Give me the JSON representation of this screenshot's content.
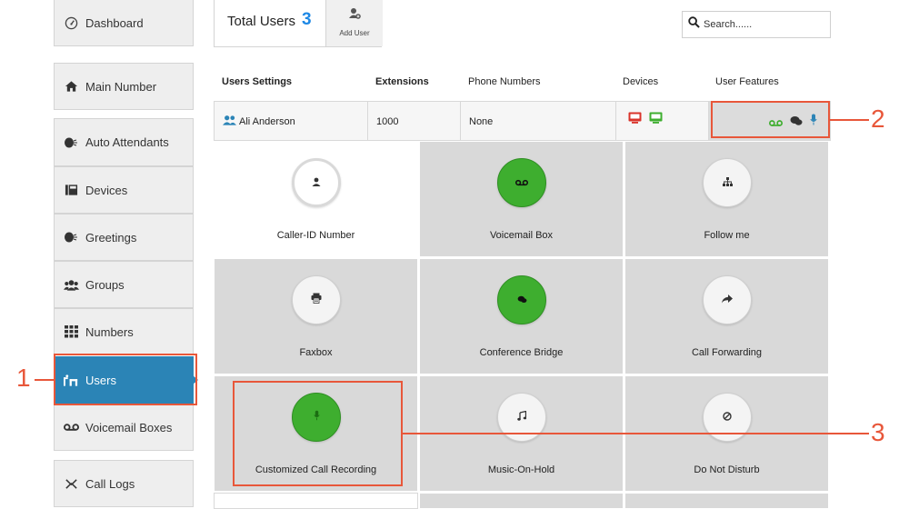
{
  "sidebar": {
    "items": [
      {
        "label": "Dashboard",
        "icon": "dashboard-icon"
      },
      {
        "label": "Main Number",
        "icon": "home-icon"
      },
      {
        "label": "Auto Attendants",
        "icon": "speaker-head-icon"
      },
      {
        "label": "Devices",
        "icon": "devices-icon"
      },
      {
        "label": "Greetings",
        "icon": "speaker-head-icon"
      },
      {
        "label": "Groups",
        "icon": "group-icon"
      },
      {
        "label": "Numbers",
        "icon": "keypad-icon"
      },
      {
        "label": "Users",
        "icon": "users-icon",
        "active": true
      },
      {
        "label": "Voicemail Boxes",
        "icon": "voicemail-icon"
      },
      {
        "label": "Call Logs",
        "icon": "call-logs-icon"
      }
    ],
    "active_color": "#2b84b6"
  },
  "header": {
    "total_label": "Total Users",
    "total_count": "3",
    "add_user_label": "Add User",
    "search_placeholder": "Search......"
  },
  "table": {
    "columns": [
      "Users Settings",
      "Extensions",
      "Phone Numbers",
      "Devices",
      "User Features"
    ],
    "rows": [
      {
        "name": "Ali Anderson",
        "extension": "1000",
        "phone_numbers": "None"
      }
    ]
  },
  "features": [
    {
      "label": "Caller-ID Number",
      "icon": "person-icon",
      "state": "selected"
    },
    {
      "label": "Voicemail Box",
      "icon": "voicemail-icon",
      "state": "enabled"
    },
    {
      "label": "Follow me",
      "icon": "sitemap-icon",
      "state": "disabled"
    },
    {
      "label": "Faxbox",
      "icon": "fax-icon",
      "state": "disabled"
    },
    {
      "label": "Conference Bridge",
      "icon": "chat-icon",
      "state": "enabled"
    },
    {
      "label": "Call Forwarding",
      "icon": "share-arrow-icon",
      "state": "disabled"
    },
    {
      "label": "Customized Call Recording",
      "icon": "microphone-icon",
      "state": "enabled"
    },
    {
      "label": "Music-On-Hold",
      "icon": "music-icon",
      "state": "disabled"
    },
    {
      "label": "Do Not Disturb",
      "icon": "ban-icon",
      "state": "disabled"
    }
  ],
  "annotations": [
    {
      "number": "1",
      "target": "Users"
    },
    {
      "number": "2",
      "target": "User Features"
    },
    {
      "number": "3",
      "target": "Customized Call Recording"
    }
  ],
  "colors": {
    "accent": "#2b84b6",
    "count": "#1e88e5",
    "enabled_green": "#3eae2f",
    "annotation": "#e8573a",
    "device_red": "#d9342b",
    "device_green": "#3eae2f"
  }
}
